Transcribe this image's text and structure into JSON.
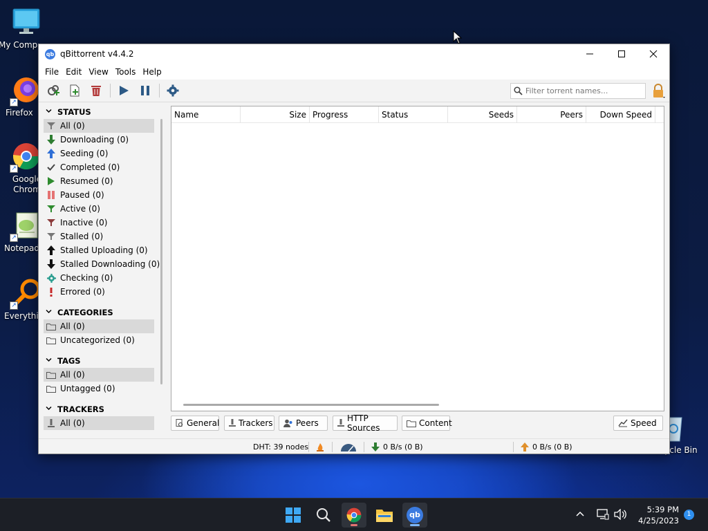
{
  "desktop": {
    "icons": [
      {
        "label": "My Comp",
        "name": "my-computer"
      },
      {
        "label": "Firefox",
        "name": "firefox"
      },
      {
        "label": "Google\nChrom",
        "name": "google-chrome"
      },
      {
        "label": "Notepad",
        "name": "notepad"
      },
      {
        "label": "Everythi",
        "name": "everything"
      }
    ],
    "recycle_bin_label": "Recycle Bin"
  },
  "window": {
    "title": "qBittorrent v4.4.2",
    "app_icon_text": "qb",
    "controls": {
      "minimize": "—",
      "maximize": "☐",
      "close": "✕"
    }
  },
  "menu": [
    "File",
    "Edit",
    "View",
    "Tools",
    "Help"
  ],
  "toolbar": {
    "search_placeholder": "Filter torrent names..."
  },
  "sidebar": {
    "status": {
      "header": "STATUS",
      "items": [
        {
          "label": "All (0)",
          "icon": "filter-gray"
        },
        {
          "label": "Downloading (0)",
          "icon": "arrow-down-green"
        },
        {
          "label": "Seeding (0)",
          "icon": "arrow-up-blue"
        },
        {
          "label": "Completed (0)",
          "icon": "check"
        },
        {
          "label": "Resumed (0)",
          "icon": "play-green"
        },
        {
          "label": "Paused (0)",
          "icon": "pause-red"
        },
        {
          "label": "Active (0)",
          "icon": "filter-green"
        },
        {
          "label": "Inactive (0)",
          "icon": "filter-red"
        },
        {
          "label": "Stalled (0)",
          "icon": "filter-gray"
        },
        {
          "label": "Stalled Uploading (0)",
          "icon": "arrow-up-black"
        },
        {
          "label": "Stalled Downloading (0)",
          "icon": "arrow-down-black"
        },
        {
          "label": "Checking (0)",
          "icon": "gear-teal"
        },
        {
          "label": "Errored (0)",
          "icon": "exclamation-red"
        }
      ]
    },
    "categories": {
      "header": "CATEGORIES",
      "items": [
        {
          "label": "All (0)",
          "icon": "folder"
        },
        {
          "label": "Uncategorized (0)",
          "icon": "folder"
        }
      ]
    },
    "tags": {
      "header": "TAGS",
      "items": [
        {
          "label": "All (0)",
          "icon": "folder"
        },
        {
          "label": "Untagged (0)",
          "icon": "folder"
        }
      ]
    },
    "trackers": {
      "header": "TRACKERS",
      "items": [
        {
          "label": "All (0)",
          "icon": "tracker"
        }
      ]
    }
  },
  "table": {
    "columns": [
      "Name",
      "Size",
      "Progress",
      "Status",
      "Seeds",
      "Peers",
      "Down Speed"
    ]
  },
  "tabs": [
    "General",
    "Trackers",
    "Peers",
    "HTTP Sources",
    "Content"
  ],
  "speed_button": "Speed",
  "statusbar": {
    "dht": "DHT: 39 nodes",
    "down": "0 B/s (0 B)",
    "up": "0 B/s (0 B)"
  },
  "taskbar": {
    "time": "5:39 PM",
    "date": "4/25/2023",
    "notification_count": "1"
  },
  "colors": {
    "accent": "#3b7be0",
    "green": "#2e8b2e",
    "blue": "#2f6fd6",
    "red": "#c62828"
  }
}
